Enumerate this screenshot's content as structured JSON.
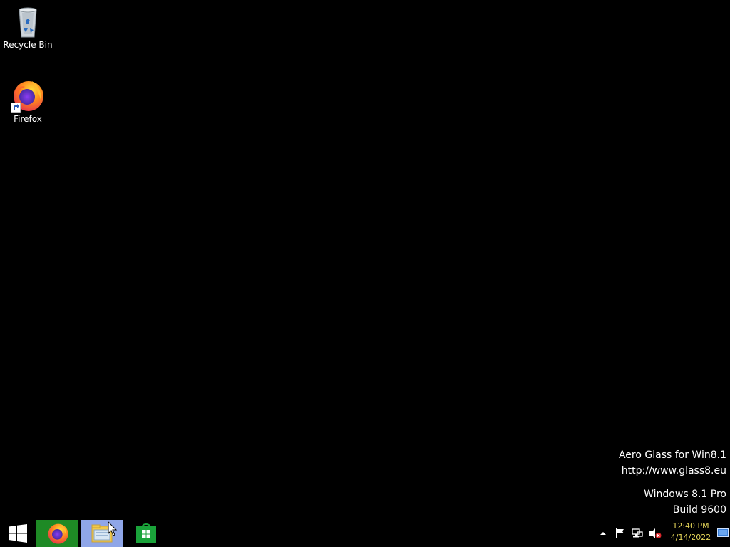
{
  "desktop": {
    "background_color": "#000000",
    "icons": [
      {
        "label": "Recycle Bin",
        "icon": "recycle-bin-icon"
      },
      {
        "label": "Firefox",
        "icon": "firefox-icon",
        "shortcut": true
      }
    ],
    "watermark": {
      "line1": "Aero Glass for Win8.1",
      "line2": "http://www.glass8.eu",
      "line3": "Windows 8.1 Pro",
      "line4": "Build 9600"
    }
  },
  "taskbar": {
    "buttons": [
      {
        "name": "start",
        "icon": "windows-logo-icon"
      },
      {
        "name": "firefox",
        "icon": "firefox-icon",
        "color": "#1e8a25"
      },
      {
        "name": "file-explorer",
        "icon": "folder-icon",
        "color": "#8fa6e8"
      },
      {
        "name": "store",
        "icon": "store-icon"
      }
    ],
    "tray": {
      "icons": [
        "chevron-up-icon",
        "flag-icon",
        "network-icon",
        "speaker-muted-icon"
      ],
      "time": "12:40 PM",
      "date": "4/14/2022",
      "clock_color": "#e8d85a"
    }
  }
}
